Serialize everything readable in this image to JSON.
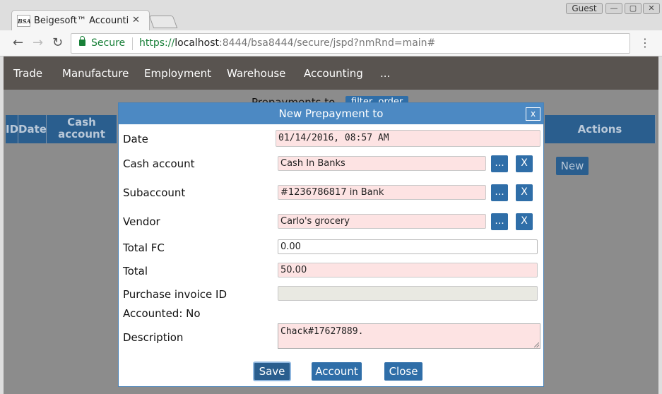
{
  "browser": {
    "tab_logo": "BSA",
    "tab_title": "Beigesoft™ Accounti",
    "tab_close": "✕",
    "profile": "Guest",
    "win_min": "—",
    "win_max": "▢",
    "win_close": "✕",
    "back": "←",
    "forward": "→",
    "reload": "↻",
    "secure_label": "Secure",
    "url_scheme": "https://",
    "url_host": "localhost",
    "url_rest": ":8444/bsa8444/secure/jspd?nmRnd=main#",
    "menu": "⋮"
  },
  "nav": {
    "items": [
      "Trade",
      "Manufacture",
      "Employment",
      "Warehouse",
      "Accounting",
      "..."
    ]
  },
  "list": {
    "title": "Prepayments to",
    "filter_label": "filter, order",
    "columns": [
      "ID",
      "Date",
      "Cash account",
      "Actions"
    ],
    "new_label": "New"
  },
  "dialog": {
    "title": "New Prepayment to",
    "close_label": "x",
    "fields": {
      "date": {
        "label": "Date",
        "value": "01/14/2016, 08:57 AM"
      },
      "cash_account": {
        "label": "Cash account",
        "value": "Cash In Banks"
      },
      "subaccount": {
        "label": "Subaccount",
        "value": "#1236786817 in Bank"
      },
      "vendor": {
        "label": "Vendor",
        "value": "Carlo's grocery"
      },
      "total_fc": {
        "label": "Total FC",
        "value": "0.00"
      },
      "total": {
        "label": "Total",
        "value": "50.00"
      },
      "purchase_invoice_id": {
        "label": "Purchase invoice ID",
        "value": ""
      },
      "accounted": {
        "label": "Accounted: No"
      },
      "description": {
        "label": "Description",
        "value": "Chack#17627889."
      }
    },
    "pick_label": "...",
    "clear_label": "X",
    "buttons": {
      "save": "Save",
      "account": "Account",
      "close": "Close"
    }
  }
}
